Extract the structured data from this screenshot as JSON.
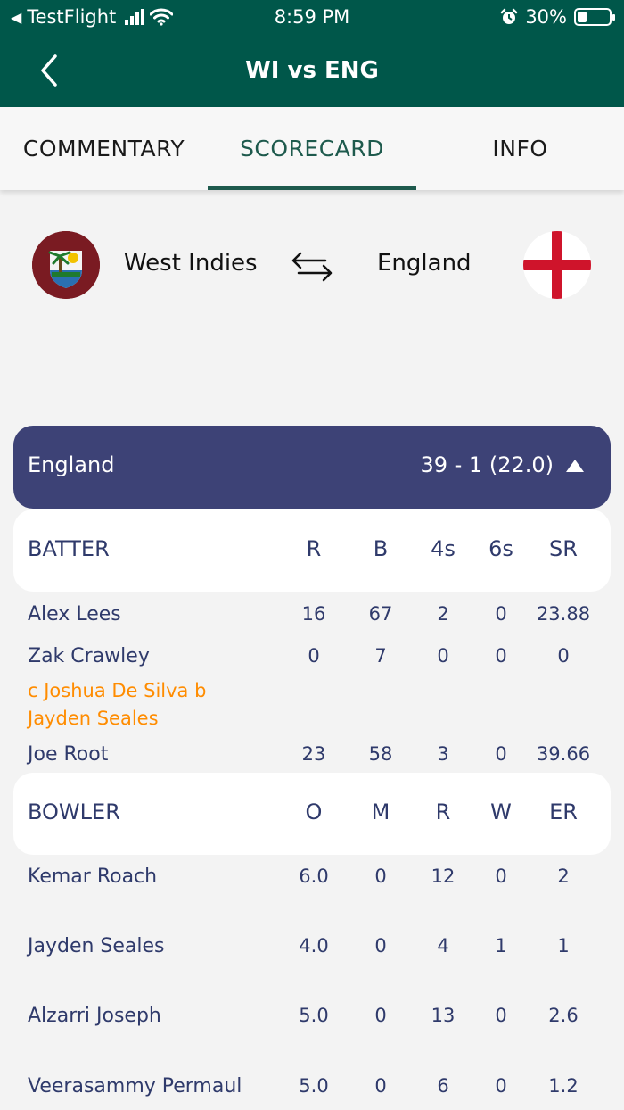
{
  "status_bar": {
    "carrier": "TestFlight",
    "time": "8:59 PM",
    "battery": "30%",
    "battery_level": 0.3
  },
  "header": {
    "title": "WI vs ENG"
  },
  "tabs": [
    {
      "label": "COMMENTARY",
      "active": false
    },
    {
      "label": "SCORECARD",
      "active": true
    },
    {
      "label": "INFO",
      "active": false
    }
  ],
  "teams": {
    "home": "West Indies",
    "away": "England"
  },
  "innings": {
    "team": "England",
    "score": "39 - 1 (22.0)"
  },
  "batting": {
    "header": "BATTER",
    "columns": [
      "R",
      "B",
      "4s",
      "6s",
      "SR"
    ],
    "rows": [
      {
        "name": "Alex Lees",
        "stats": [
          "16",
          "67",
          "2",
          "0",
          "23.88"
        ]
      },
      {
        "name": "Zak Crawley",
        "stats": [
          "0",
          "7",
          "0",
          "0",
          "0"
        ],
        "dismissal": "c Joshua De Silva b Jayden Seales"
      },
      {
        "name": "Joe Root",
        "stats": [
          "23",
          "58",
          "3",
          "0",
          "39.66"
        ]
      }
    ]
  },
  "bowling": {
    "header": "BOWLER",
    "columns": [
      "O",
      "M",
      "R",
      "W",
      "ER"
    ],
    "rows": [
      {
        "name": "Kemar Roach",
        "stats": [
          "6.0",
          "0",
          "12",
          "0",
          "2"
        ]
      },
      {
        "name": "Jayden Seales",
        "stats": [
          "4.0",
          "0",
          "4",
          "1",
          "1"
        ]
      },
      {
        "name": "Alzarri Joseph",
        "stats": [
          "5.0",
          "0",
          "13",
          "0",
          "2.6"
        ]
      },
      {
        "name": "Veerasammy Permaul",
        "stats": [
          "5.0",
          "0",
          "6",
          "0",
          "1.2"
        ]
      }
    ]
  },
  "colors": {
    "header_green": "#00574a",
    "accent_green": "#1e5a4d",
    "innings_bar": "#3d4276",
    "text_navy": "#2f3a6b",
    "dismissal_orange": "#ff8c00"
  }
}
